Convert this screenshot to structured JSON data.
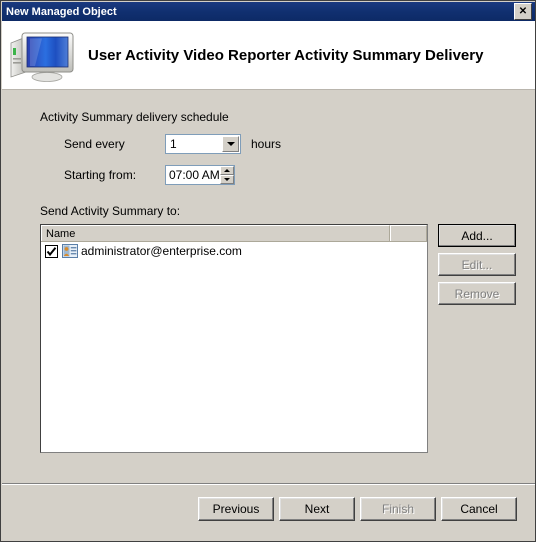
{
  "window": {
    "title": "New Managed Object",
    "close_label": "✕"
  },
  "header": {
    "title": "User Activity Video Reporter Activity Summary Delivery",
    "icon": "computer-monitor-icon"
  },
  "schedule": {
    "group_label": "Activity Summary delivery schedule",
    "send_every_label": "Send every",
    "send_every_value": "1",
    "hours_label": "hours",
    "starting_from_label": "Starting from:",
    "starting_from_value": "07:00 AM"
  },
  "recipients": {
    "section_label": "Send Activity Summary to:",
    "columns": [
      "Name",
      ""
    ],
    "rows": [
      {
        "checked": true,
        "icon": "user-contact-icon",
        "name": "administrator@enterprise.com"
      }
    ],
    "buttons": [
      {
        "label": "Add...",
        "enabled": true
      },
      {
        "label": "Edit...",
        "enabled": false
      },
      {
        "label": "Remove",
        "enabled": false
      }
    ]
  },
  "footer": {
    "buttons": [
      {
        "label": "Previous",
        "enabled": true
      },
      {
        "label": "Next",
        "enabled": true
      },
      {
        "label": "Finish",
        "enabled": false
      },
      {
        "label": "Cancel",
        "enabled": true
      }
    ]
  },
  "colors": {
    "titlebar": "#113070",
    "face": "#d4d0c8",
    "field": "#ffffff",
    "disabled_text": "#808080"
  }
}
